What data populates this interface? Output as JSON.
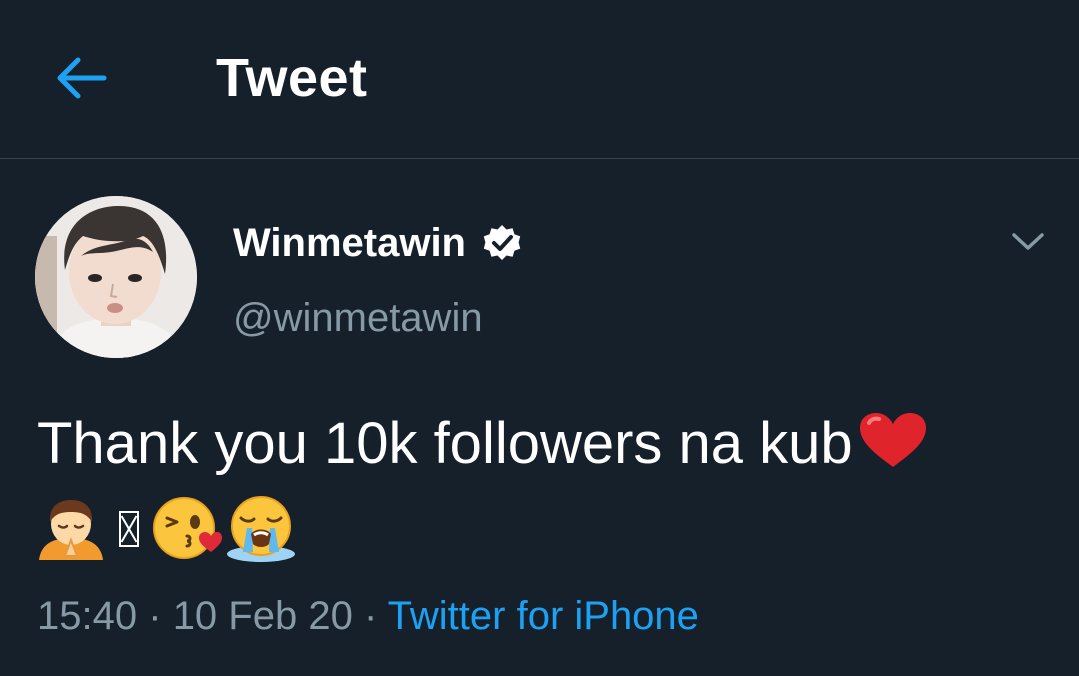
{
  "header": {
    "title": "Tweet"
  },
  "author": {
    "display_name": "Winmetawin",
    "handle": "@winmetawin",
    "verified": true
  },
  "tweet": {
    "text": "Thank you 10k followers na kub",
    "emojis": [
      "heart-icon",
      "person-bowing-icon",
      "missing-glyph-box",
      "face-blowing-kiss-icon",
      "loudly-crying-face-icon"
    ]
  },
  "meta": {
    "time": "15:40",
    "separator": "·",
    "date": "10 Feb 20",
    "source": "Twitter for iPhone"
  },
  "colors": {
    "background": "#15202b",
    "accent": "#1da1f2",
    "secondary_text": "#8899a6",
    "divider": "#38444d"
  }
}
